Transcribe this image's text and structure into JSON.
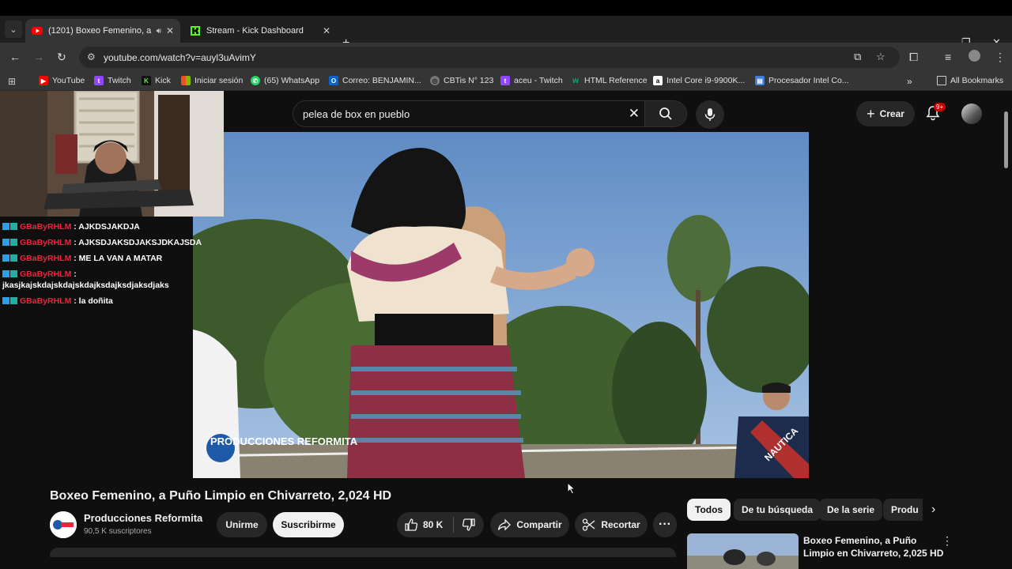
{
  "browser": {
    "tabs": [
      {
        "label": "(1201) Boxeo Femenino, a Pu",
        "active": true
      },
      {
        "label": "Stream - Kick Dashboard",
        "active": false
      }
    ],
    "url": "youtube.com/watch?v=auyl3uAvimY",
    "bookmarks": [
      {
        "label": "YouTube",
        "icon": "youtube-icon"
      },
      {
        "label": "Twitch",
        "icon": "twitch-icon"
      },
      {
        "label": "Kick",
        "icon": "kick-icon"
      },
      {
        "label": "Iniciar sesión",
        "icon": "microsoft-icon"
      },
      {
        "label": "(65) WhatsApp",
        "icon": "whatsapp-icon"
      },
      {
        "label": "Correo: BENJAMIN...",
        "icon": "outlook-icon"
      },
      {
        "label": "CBTis N° 123",
        "icon": "globe-icon"
      },
      {
        "label": "aceu - Twitch",
        "icon": "twitch-icon"
      },
      {
        "label": "HTML Reference",
        "icon": "w3-icon"
      },
      {
        "label": "Intel Core i9-9900K...",
        "icon": "amazon-icon"
      },
      {
        "label": "Procesador Intel Co...",
        "icon": "page-icon"
      }
    ],
    "all_bookmarks": "All Bookmarks"
  },
  "youtube": {
    "search_query": "pelea de box en pueblo",
    "create_label": "Crear",
    "notification_badge": "9+",
    "video_title": "Boxeo Femenino, a Puño Limpio en Chivarreto, 2,024 HD",
    "watermark": "PRODUCCIONES REFORMITA",
    "jacket_text": "NAUTICA",
    "channel_name": "Producciones  Reformita",
    "subscribers": "90,5 K suscriptores",
    "join_label": "Unirme",
    "subscribe_label": "Suscribirme",
    "likes": "80 K",
    "share_label": "Compartir",
    "clip_label": "Recortar",
    "chips": [
      "Todos",
      "De tu búsqueda",
      "De la serie",
      "Produ"
    ],
    "related_title": "Boxeo Femenino, a Puño Limpio en Chivarreto, 2,025 HD"
  },
  "chat": [
    {
      "user": "GBaByRHLM",
      "message": ": AJKDSJAKDJA"
    },
    {
      "user": "GBaByRHLM",
      "message": ": AJKSDJAKSDJAKSJDKAJSDA"
    },
    {
      "user": "GBaByRHLM",
      "message": ": ME LA VAN A MATAR"
    },
    {
      "user": "GBaByRHLM",
      "message": ": jkasjkajskdajskdajskdajksdajksdjaksdjaks"
    },
    {
      "user": "GBaByRHLM",
      "message": ": la doñita"
    }
  ],
  "colors": {
    "youtube_red": "#ff0000",
    "chat_username": "#e8263c",
    "kick_green": "#53fc18",
    "twitch_purple": "#9146ff"
  }
}
